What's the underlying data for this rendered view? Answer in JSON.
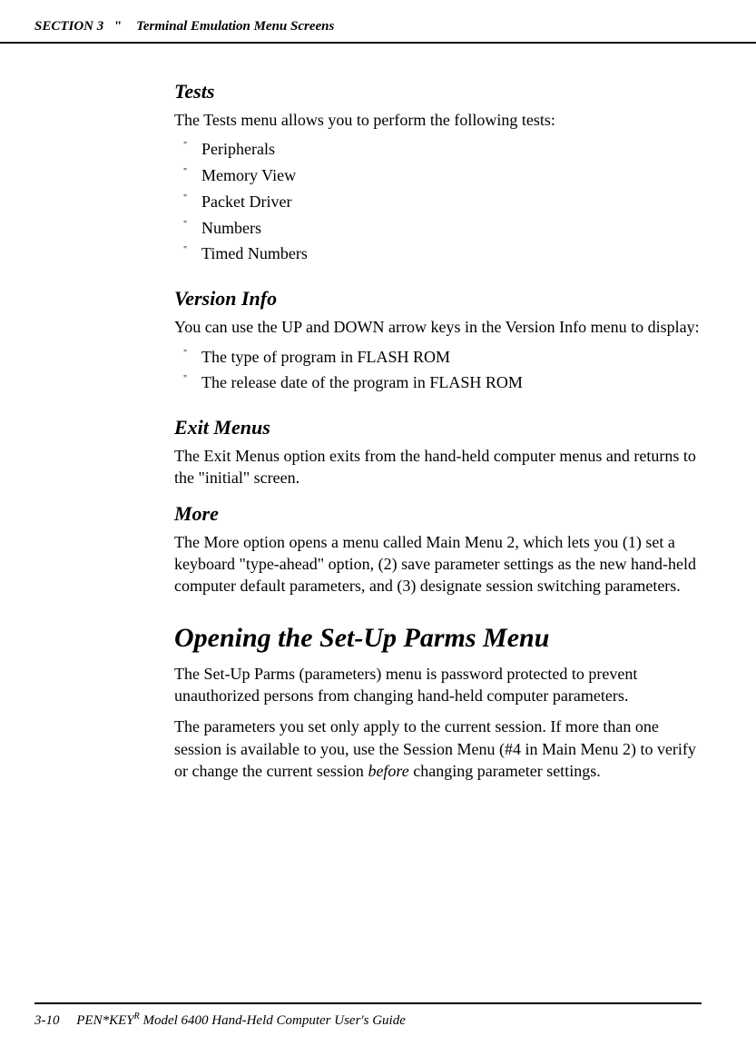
{
  "header": {
    "section": "SECTION 3",
    "title": "Terminal Emulation Menu Screens"
  },
  "tests": {
    "heading": "Tests",
    "intro": "The Tests menu allows you to perform the following tests:",
    "items": [
      "Peripherals",
      "Memory View",
      "Packet Driver",
      "Numbers",
      "Timed Numbers"
    ]
  },
  "versionInfo": {
    "heading": "Version Info",
    "intro": "You can use the UP and DOWN arrow keys in the Version Info menu to display:",
    "items": [
      "The type of program in FLASH ROM",
      "The release date of the program in FLASH ROM"
    ]
  },
  "exitMenus": {
    "heading": "Exit Menus",
    "body": "The Exit Menus option exits from the hand-held computer menus and returns to the \"initial\" screen."
  },
  "more": {
    "heading": "More",
    "body": "The More option opens a menu called Main Menu 2, which lets you (1) set a keyboard \"type-ahead\" option, (2) save parameter settings as the new hand-held computer default parameters, and (3) designate session switching parameters."
  },
  "setUpParms": {
    "heading": "Opening the Set-Up Parms Menu",
    "para1": "The Set-Up Parms (parameters) menu is password protected to prevent unauthorized persons from changing hand-held computer parameters.",
    "para2a": "The parameters you set only apply to the current session. If more than one session is available to you, use the Session Menu (#4 in Main Menu 2) to verify or change the current session ",
    "para2italic": "before",
    "para2b": " changing parameter settings."
  },
  "footer": {
    "pageNum": "3-10",
    "product": "PEN*KEY",
    "sup": "R",
    "rest": " Model 6400 Hand-Held Computer User's Guide"
  }
}
